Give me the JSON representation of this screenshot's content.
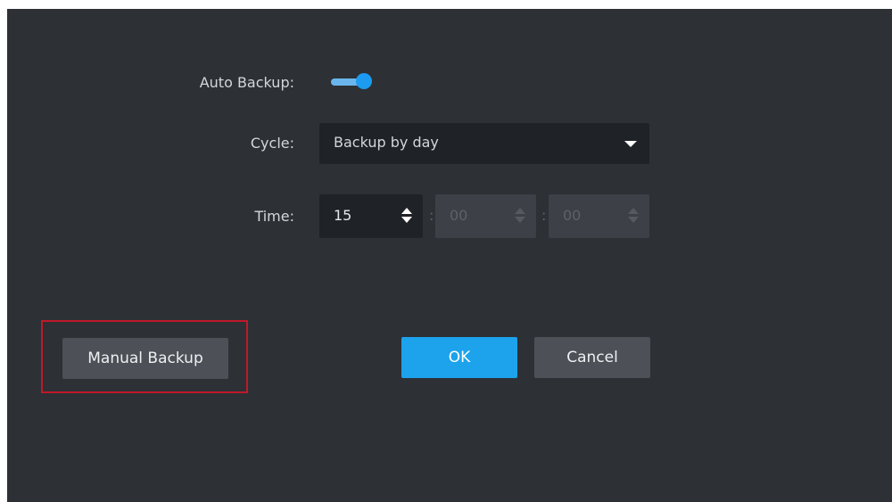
{
  "form": {
    "auto_backup_label": "Auto Backup:",
    "auto_backup_enabled": true,
    "cycle_label": "Cycle:",
    "cycle_value": "Backup by day",
    "time_label": "Time:",
    "time_hour": "15",
    "time_minute": "00",
    "time_second": "00",
    "time_separator": ":"
  },
  "buttons": {
    "manual_backup": "Manual Backup",
    "ok": "OK",
    "cancel": "Cancel"
  },
  "icons": {
    "cycle_dropdown": "caret-down-icon",
    "hour_spinner": "spinner-arrows-icon"
  },
  "colors": {
    "background": "#2d3035",
    "accent": "#1ca3ec",
    "highlight_box": "#c0182a"
  }
}
